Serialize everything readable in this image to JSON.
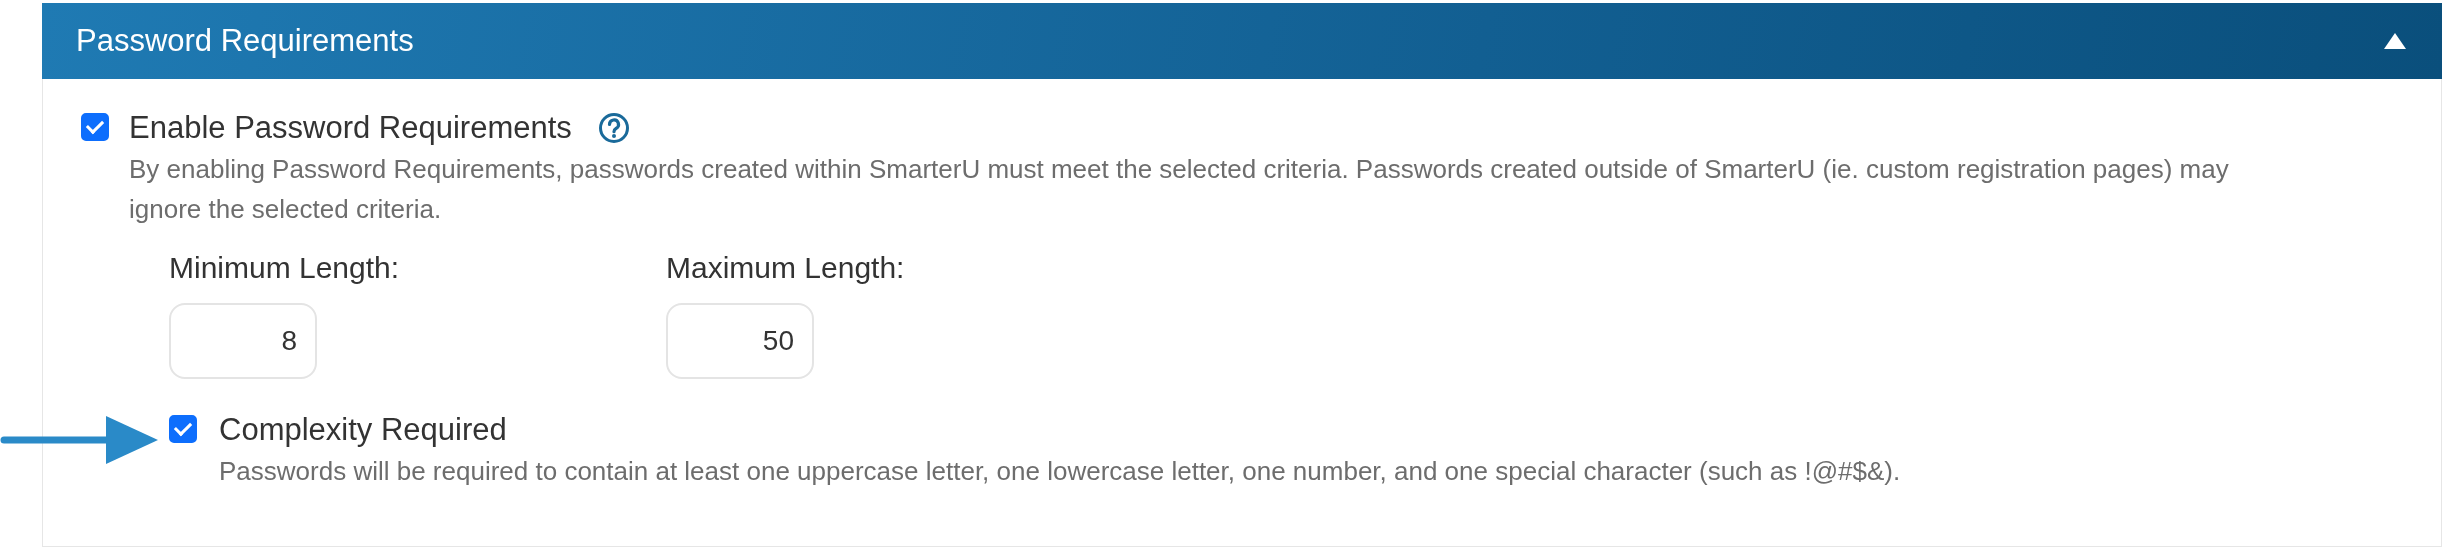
{
  "panel": {
    "title": "Password Requirements",
    "expanded": true
  },
  "enable": {
    "label": "Enable Password Requirements",
    "checked": true,
    "description": "By enabling Password Requirements, passwords created within SmarterU must meet the selected criteria. Passwords created outside of SmarterU (ie. custom registration pages) may ignore the selected criteria."
  },
  "fields": [
    {
      "label": "Minimum Length:",
      "value": "8"
    },
    {
      "label": "Maximum Length:",
      "value": "50"
    }
  ],
  "complexity": {
    "label": "Complexity Required",
    "checked": true,
    "description": "Passwords will be required to contain at least one uppercase letter, one lowercase letter, one number, and one special character (such as !@#$&)."
  }
}
